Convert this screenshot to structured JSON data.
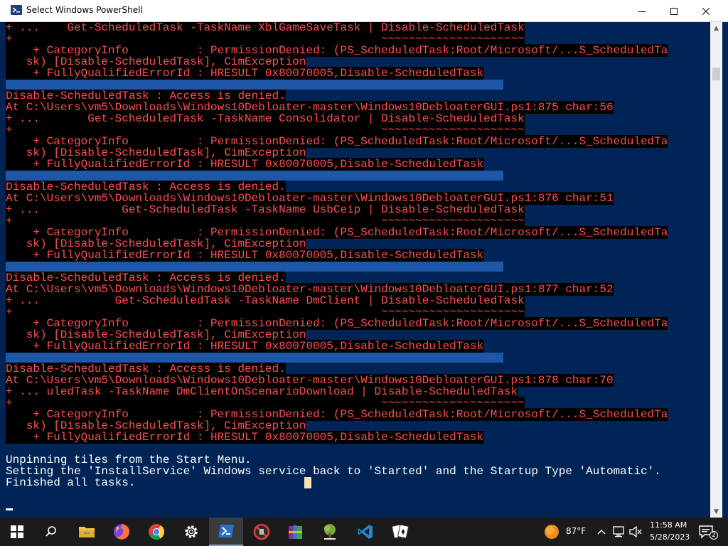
{
  "window": {
    "title": "Select Windows PowerShell",
    "min_icon": "minimize-icon",
    "max_icon": "maximize-icon",
    "close_icon": "close-icon"
  },
  "colors": {
    "console_bg": "#012456",
    "error_text": "#ff4e4e",
    "normal_text": "#ffffff",
    "taskbar_bg": "#1b1b1b"
  },
  "console": {
    "lines": [
      {
        "text": "+ ...    Get-ScheduledTask -TaskName XblGameSaveTask | Disable-ScheduledTask",
        "kind": "err"
      },
      {
        "text": "+                                                      ~~~~~~~~~~~~~~~~~~~~~",
        "kind": "err"
      },
      {
        "text": "    + CategoryInfo          : PermissionDenied: (PS_ScheduledTask:Root/Microsoft/...S_ScheduledTa",
        "kind": "err"
      },
      {
        "text": "   sk) [Disable-ScheduledTask], CimException",
        "kind": "err"
      },
      {
        "text": "    + FullyQualifiedErrorId : HRESULT 0x80070005,Disable-ScheduledTask",
        "kind": "err"
      },
      {
        "text": "",
        "kind": "err"
      },
      {
        "text": "Disable-ScheduledTask : Access is denied.",
        "kind": "err"
      },
      {
        "text": "At C:\\Users\\vm5\\Downloads\\Windows10Debloater-master\\Windows10DebloaterGUI.ps1:875 char:56",
        "kind": "err"
      },
      {
        "text": "+ ...       Get-ScheduledTask -TaskName Consolidator | Disable-ScheduledTask",
        "kind": "err"
      },
      {
        "text": "+                                                      ~~~~~~~~~~~~~~~~~~~~~",
        "kind": "err"
      },
      {
        "text": "    + CategoryInfo          : PermissionDenied: (PS_ScheduledTask:Root/Microsoft/...S_ScheduledTa",
        "kind": "err"
      },
      {
        "text": "   sk) [Disable-ScheduledTask], CimException",
        "kind": "err"
      },
      {
        "text": "    + FullyQualifiedErrorId : HRESULT 0x80070005,Disable-ScheduledTask",
        "kind": "err"
      },
      {
        "text": "",
        "kind": "err"
      },
      {
        "text": "Disable-ScheduledTask : Access is denied.",
        "kind": "err"
      },
      {
        "text": "At C:\\Users\\vm5\\Downloads\\Windows10Debloater-master\\Windows10DebloaterGUI.ps1:876 char:51",
        "kind": "err"
      },
      {
        "text": "+ ...            Get-ScheduledTask -TaskName UsbCeip | Disable-ScheduledTask",
        "kind": "err"
      },
      {
        "text": "+                                                      ~~~~~~~~~~~~~~~~~~~~~",
        "kind": "err"
      },
      {
        "text": "    + CategoryInfo          : PermissionDenied: (PS_ScheduledTask:Root/Microsoft/...S_ScheduledTa",
        "kind": "err"
      },
      {
        "text": "   sk) [Disable-ScheduledTask], CimException",
        "kind": "err"
      },
      {
        "text": "    + FullyQualifiedErrorId : HRESULT 0x80070005,Disable-ScheduledTask",
        "kind": "err"
      },
      {
        "text": "",
        "kind": "err"
      },
      {
        "text": "Disable-ScheduledTask : Access is denied.",
        "kind": "err"
      },
      {
        "text": "At C:\\Users\\vm5\\Downloads\\Windows10Debloater-master\\Windows10DebloaterGUI.ps1:877 char:52",
        "kind": "err"
      },
      {
        "text": "+ ...           Get-ScheduledTask -TaskName DmClient | Disable-ScheduledTask",
        "kind": "err"
      },
      {
        "text": "+                                                      ~~~~~~~~~~~~~~~~~~~~~",
        "kind": "err"
      },
      {
        "text": "    + CategoryInfo          : PermissionDenied: (PS_ScheduledTask:Root/Microsoft/...S_ScheduledTa",
        "kind": "err"
      },
      {
        "text": "   sk) [Disable-ScheduledTask], CimException",
        "kind": "err"
      },
      {
        "text": "    + FullyQualifiedErrorId : HRESULT 0x80070005,Disable-ScheduledTask",
        "kind": "err"
      },
      {
        "text": "",
        "kind": "err"
      },
      {
        "text": "Disable-ScheduledTask : Access is denied.",
        "kind": "err"
      },
      {
        "text": "At C:\\Users\\vm5\\Downloads\\Windows10Debloater-master\\Windows10DebloaterGUI.ps1:878 char:70",
        "kind": "err"
      },
      {
        "text": "+ ... uledTask -TaskName DmClientOnScenarioDownload | Disable-ScheduledTask",
        "kind": "err"
      },
      {
        "text": "+                                                      ~~~~~~~~~~~~~~~~~~~~~",
        "kind": "err"
      },
      {
        "text": "    + CategoryInfo          : PermissionDenied: (PS_ScheduledTask:Root/Microsoft/...S_ScheduledTa",
        "kind": "err"
      },
      {
        "text": "   sk) [Disable-ScheduledTask], CimException",
        "kind": "err"
      },
      {
        "text": "    + FullyQualifiedErrorId : HRESULT 0x80070005,Disable-ScheduledTask",
        "kind": "err"
      },
      {
        "text": "",
        "kind": "out"
      },
      {
        "text": "Unpinning tiles from the Start Menu.",
        "kind": "out"
      },
      {
        "text": "Setting the 'InstallService' Windows service back to 'Started' and the Startup Type 'Automatic'.",
        "kind": "out"
      },
      {
        "text": "Finished all tasks.",
        "kind": "out"
      }
    ]
  },
  "taskbar": {
    "items": [
      {
        "name": "start-button",
        "icon": "windows-logo-icon"
      },
      {
        "name": "search-button",
        "icon": "search-icon"
      },
      {
        "name": "file-explorer-button",
        "icon": "folder-icon"
      },
      {
        "name": "firefox-button",
        "icon": "firefox-icon"
      },
      {
        "name": "chrome-button",
        "icon": "chrome-icon"
      },
      {
        "name": "settings-button",
        "icon": "gear-icon"
      },
      {
        "name": "powershell-button",
        "icon": "powershell-icon"
      },
      {
        "name": "blocked-app-button",
        "icon": "blocked-icon"
      },
      {
        "name": "winrar-button",
        "icon": "books-icon"
      },
      {
        "name": "tree-app-button",
        "icon": "tree-icon"
      },
      {
        "name": "vscode-button",
        "icon": "vscode-icon"
      },
      {
        "name": "solitaire-button",
        "icon": "cards-icon"
      }
    ],
    "weather": {
      "temp": "87°F",
      "icon": "sun-icon"
    },
    "time": "11:58 AM",
    "date": "5/28/2023",
    "notification_count": "2"
  }
}
